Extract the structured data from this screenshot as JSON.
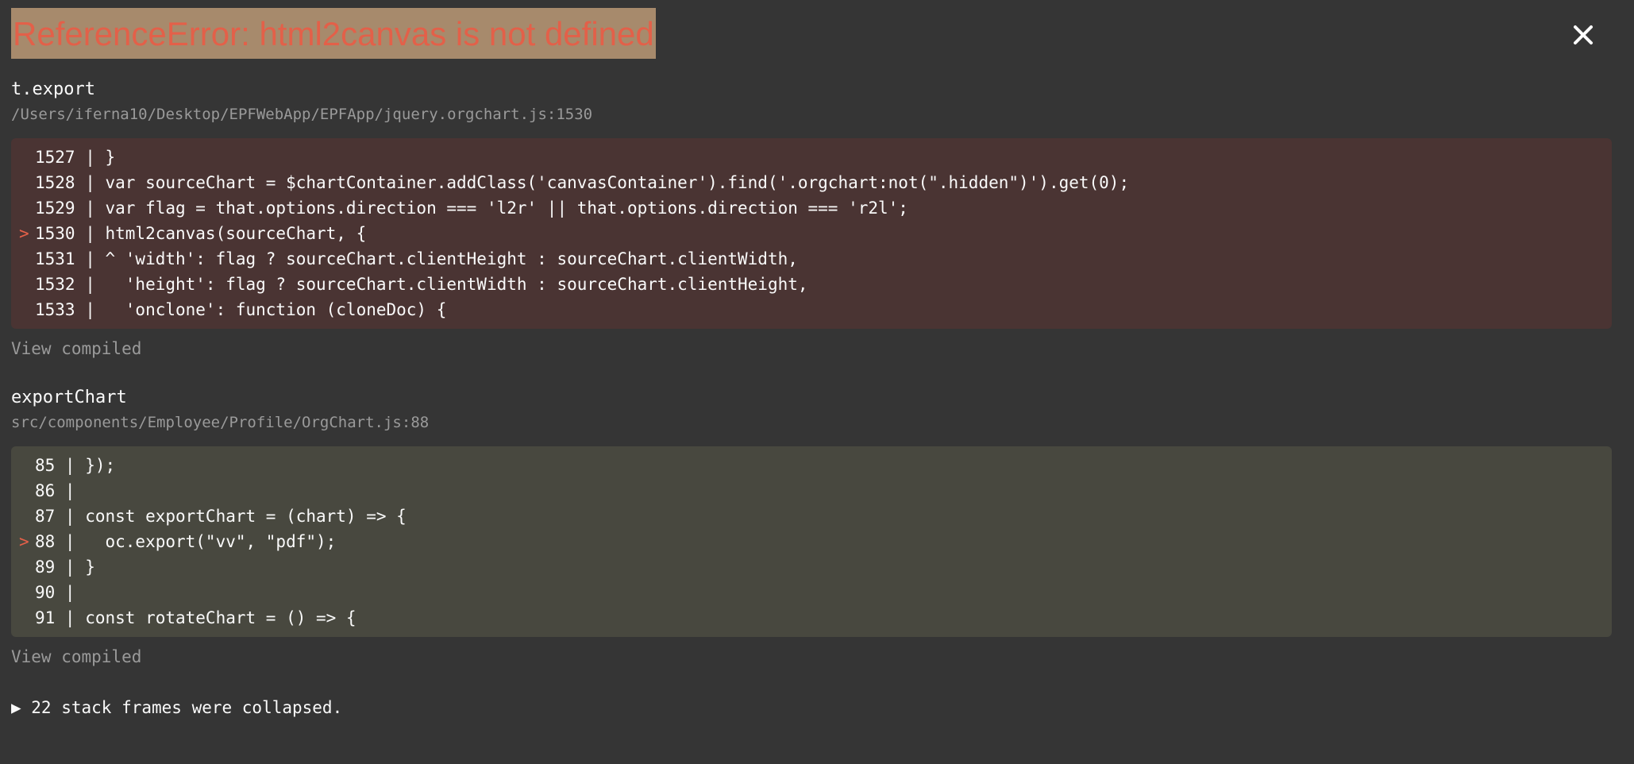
{
  "error": {
    "title": "ReferenceError: html2canvas is not defined"
  },
  "close_icon": "close-icon",
  "frames": [
    {
      "function": "t.export",
      "location": "/Users/iferna10/Desktop/EPFWebApp/EPFApp/jquery.orgchart.js:1530",
      "view_compiled": "View compiled",
      "lines": [
        {
          "marker": "",
          "text": "1527 | }"
        },
        {
          "marker": "",
          "text": "1528 | var sourceChart = $chartContainer.addClass('canvasContainer').find('.orgchart:not(\".hidden\")').get(0);"
        },
        {
          "marker": "",
          "text": "1529 | var flag = that.options.direction === 'l2r' || that.options.direction === 'r2l';"
        },
        {
          "marker": ">",
          "text": "1530 | html2canvas(sourceChart, {"
        },
        {
          "marker": "",
          "text": "1531 | ^ 'width': flag ? sourceChart.clientHeight : sourceChart.clientWidth,"
        },
        {
          "marker": "",
          "text": "1532 |   'height': flag ? sourceChart.clientWidth : sourceChart.clientHeight,"
        },
        {
          "marker": "",
          "text": "1533 |   'onclone': function (cloneDoc) {"
        }
      ]
    },
    {
      "function": "exportChart",
      "location": "src/components/Employee/Profile/OrgChart.js:88",
      "view_compiled": "View compiled",
      "lines": [
        {
          "marker": "",
          "text": "85 | });"
        },
        {
          "marker": "",
          "text": "86 |"
        },
        {
          "marker": "",
          "text": "87 | const exportChart = (chart) => {"
        },
        {
          "marker": ">",
          "text": "88 |   oc.export(\"vv\", \"pdf\");"
        },
        {
          "marker": "",
          "text": "89 | }"
        },
        {
          "marker": "",
          "text": "90 |"
        },
        {
          "marker": "",
          "text": "91 | const rotateChart = () => {"
        }
      ]
    }
  ],
  "collapsed": {
    "text": "▶ 22 stack frames were collapsed."
  },
  "colors": {
    "background": "#353535",
    "error_title": "#e36049",
    "error_title_bg": "#a78a6c",
    "frame1_bg": "#4a3433",
    "frame2_bg": "#48483f"
  }
}
